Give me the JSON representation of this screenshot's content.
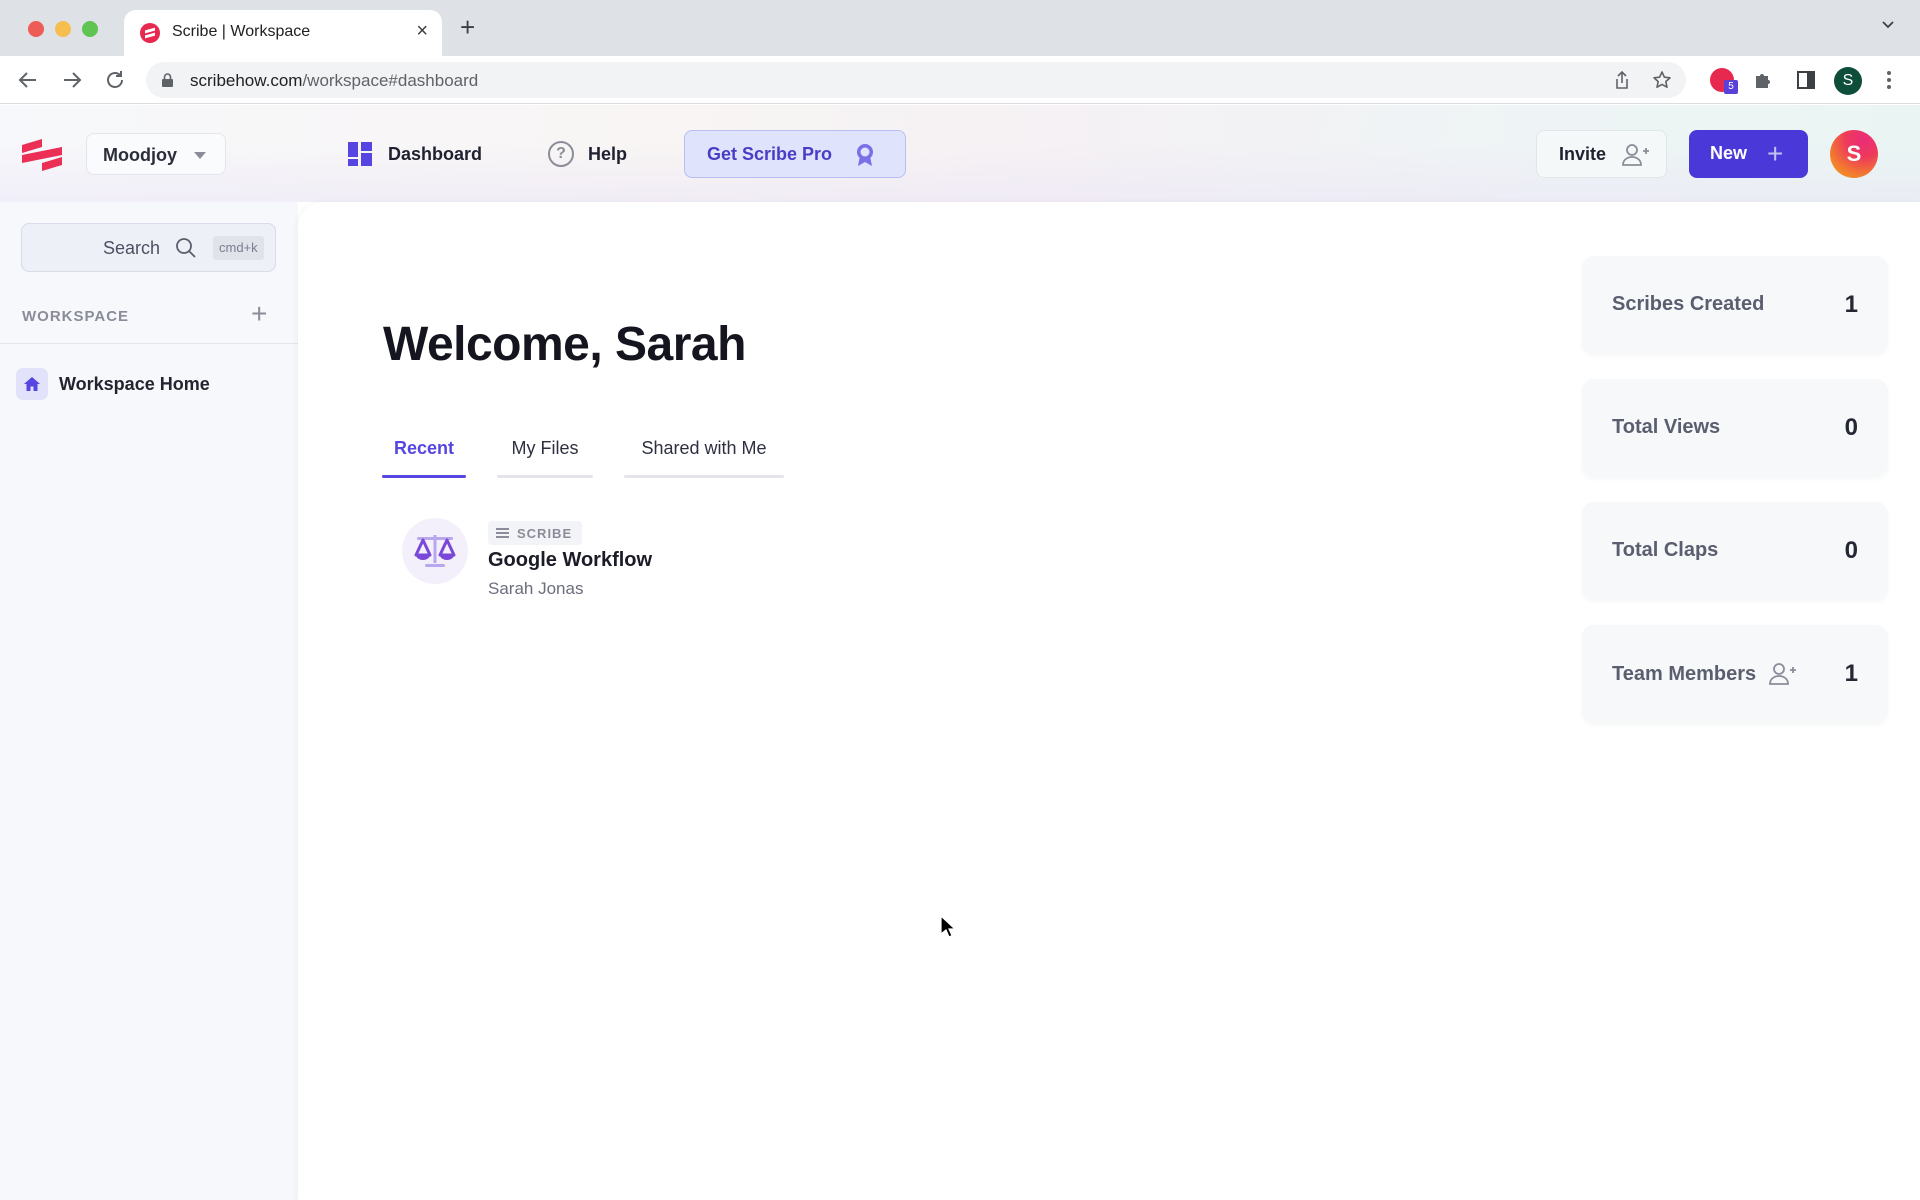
{
  "browser": {
    "tab_title": "Scribe | Workspace",
    "url_domain": "scribehow.com",
    "url_path": "/workspace#dashboard",
    "extension_badge": "5",
    "profile_initial": "S"
  },
  "header": {
    "workspace_name": "Moodjoy",
    "nav": [
      {
        "label": "Dashboard",
        "icon": "dashboard-icon"
      },
      {
        "label": "Help",
        "icon": "help-icon"
      }
    ],
    "pro_button": "Get Scribe Pro",
    "invite_button": "Invite",
    "new_button": "New",
    "new_plus": "+",
    "avatar_initial": "S"
  },
  "sidebar": {
    "search_label": "Search",
    "search_shortcut": "cmd+k",
    "section_title": "WORKSPACE",
    "section_add": "+",
    "items": [
      {
        "label": "Workspace Home",
        "icon": "home-icon"
      }
    ]
  },
  "main": {
    "welcome": "Welcome, Sarah",
    "tabs": [
      {
        "label": "Recent",
        "active": true
      },
      {
        "label": "My Files",
        "active": false
      },
      {
        "label": "Shared with Me",
        "active": false
      }
    ],
    "files": [
      {
        "type": "SCRIBE",
        "name": "Google Workflow",
        "author": "Sarah Jonas",
        "icon": "scales-icon"
      }
    ]
  },
  "stats": [
    {
      "label": "Scribes Created",
      "value": "1"
    },
    {
      "label": "Total Views",
      "value": "0"
    },
    {
      "label": "Total Claps",
      "value": "0"
    },
    {
      "label": "Team Members",
      "value": "1",
      "icon": "add-user-icon"
    }
  ],
  "colors": {
    "brand_red": "#e8294f",
    "accent_purple": "#5645e0",
    "new_button": "#4a38d8"
  }
}
